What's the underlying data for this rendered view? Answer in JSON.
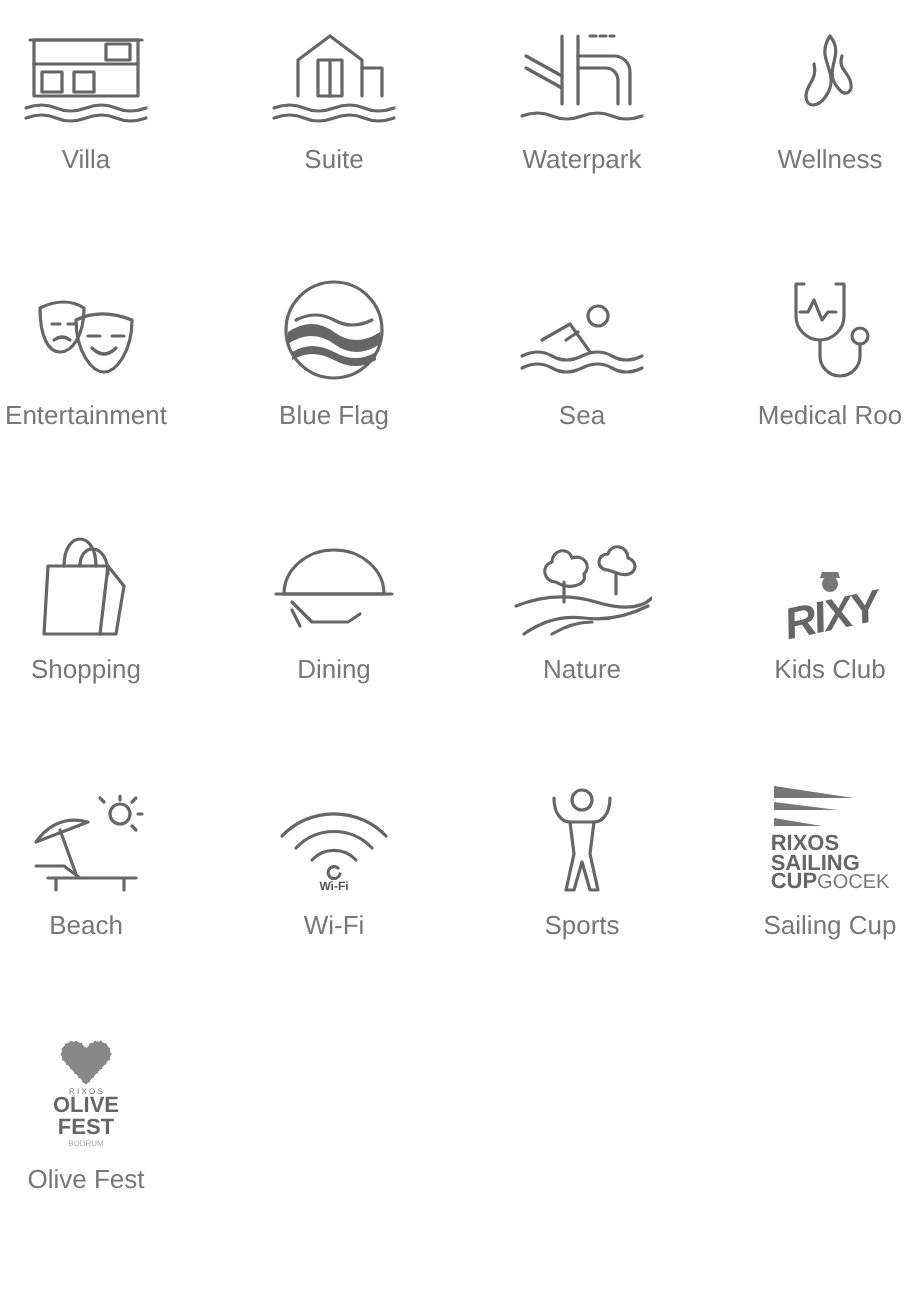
{
  "amenities": [
    {
      "label": "Villa"
    },
    {
      "label": "Suite"
    },
    {
      "label": "Waterpark"
    },
    {
      "label": "Wellness"
    },
    {
      "label": "Entertainment"
    },
    {
      "label": "Blue Flag"
    },
    {
      "label": "Sea"
    },
    {
      "label": "Medical Roo"
    },
    {
      "label": "Shopping"
    },
    {
      "label": "Dining"
    },
    {
      "label": "Nature"
    },
    {
      "label": "Kids Club",
      "logo_text": [
        "RIXY"
      ]
    },
    {
      "label": "Beach"
    },
    {
      "label": "Wi-Fi",
      "logo_text": [
        "Wi-Fi"
      ]
    },
    {
      "label": "Sports"
    },
    {
      "label": "Sailing Cup",
      "logo_text": [
        "RIXOS",
        "SAILING",
        "CUP",
        "GOCEK"
      ]
    },
    {
      "label": "Olive Fest",
      "logo_text": [
        "R I X O S",
        "OLIVE",
        "FEST",
        "BODRUM"
      ]
    }
  ]
}
